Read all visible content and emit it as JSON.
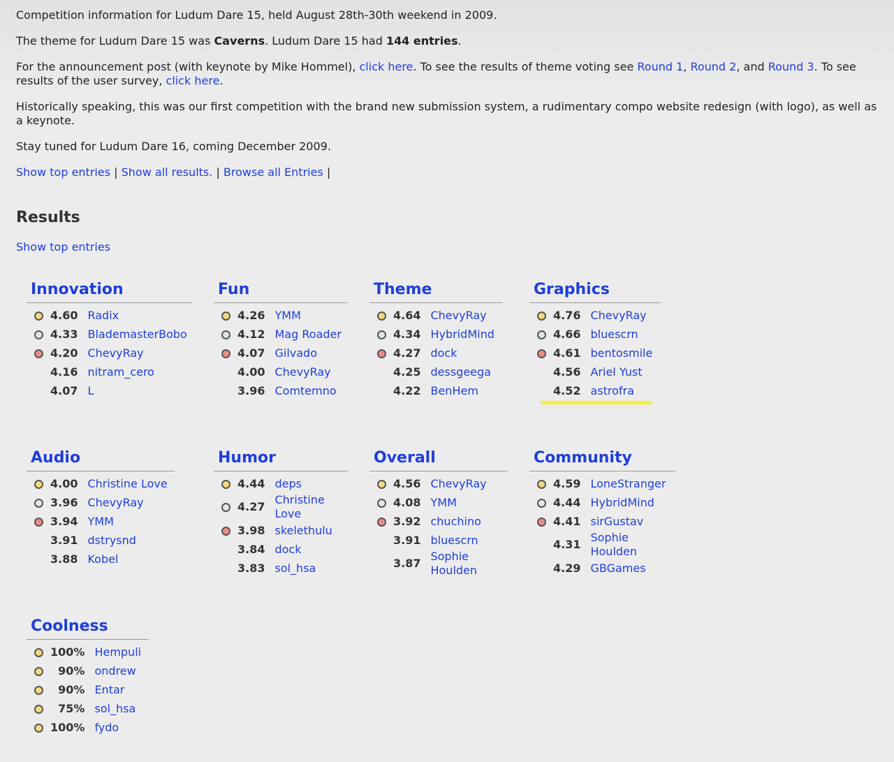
{
  "intro": {
    "line1": "Competition information for Ludum Dare 15, held August 28th-30th weekend in 2009.",
    "line2_a": "The theme for Ludum Dare 15 was ",
    "line2_theme": "Caverns",
    "line2_b": ". Ludum Dare 15 had ",
    "line2_count": "144 entries",
    "line2_c": ".",
    "line3_a": "For the announcement post (with keynote by Mike Hommel), ",
    "line3_link1": "click here",
    "line3_b": ". To see the results of theme voting see ",
    "line3_r1": "Round 1",
    "line3_c": ", ",
    "line3_r2": "Round 2",
    "line3_d": ", and ",
    "line3_r3": "Round 3",
    "line3_e": ". To see results of the user survey, ",
    "line3_link2": "click here",
    "line3_f": ".",
    "line4": "Historically speaking, this was our first competition with the brand new submission system, a rudimentary compo website redesign (with logo), as well as a keynote.",
    "line5": "Stay tuned for Ludum Dare 16, coming December 2009.",
    "nav": [
      "Show top entries",
      "Show all results.",
      "Browse all Entries"
    ]
  },
  "results_heading": "Results",
  "show_top_entries": "Show top entries",
  "categories": [
    {
      "title": "Innovation",
      "entries": [
        {
          "medal": "gold",
          "score": "4.60",
          "name": "Radix"
        },
        {
          "medal": "silver",
          "score": "4.33",
          "name": "BlademasterBobo"
        },
        {
          "medal": "bronze",
          "score": "4.20",
          "name": "ChevyRay"
        },
        {
          "medal": "",
          "score": "4.16",
          "name": "nitram_cero"
        },
        {
          "medal": "",
          "score": "4.07",
          "name": "L"
        }
      ]
    },
    {
      "title": "Fun",
      "entries": [
        {
          "medal": "gold",
          "score": "4.26",
          "name": "YMM"
        },
        {
          "medal": "silver",
          "score": "4.12",
          "name": "Mag Roader"
        },
        {
          "medal": "bronze",
          "score": "4.07",
          "name": "Gilvado"
        },
        {
          "medal": "",
          "score": "4.00",
          "name": "ChevyRay"
        },
        {
          "medal": "",
          "score": "3.96",
          "name": "Comtemno"
        }
      ]
    },
    {
      "title": "Theme",
      "entries": [
        {
          "medal": "gold",
          "score": "4.64",
          "name": "ChevyRay"
        },
        {
          "medal": "silver",
          "score": "4.34",
          "name": "HybridMind"
        },
        {
          "medal": "bronze",
          "score": "4.27",
          "name": "dock"
        },
        {
          "medal": "",
          "score": "4.25",
          "name": "dessgeega"
        },
        {
          "medal": "",
          "score": "4.22",
          "name": "BenHem"
        }
      ]
    },
    {
      "title": "Graphics",
      "entries": [
        {
          "medal": "gold",
          "score": "4.76",
          "name": "ChevyRay"
        },
        {
          "medal": "silver",
          "score": "4.66",
          "name": "bluescrn"
        },
        {
          "medal": "bronze",
          "score": "4.61",
          "name": "bentosmile"
        },
        {
          "medal": "",
          "score": "4.56",
          "name": "Ariel Yust"
        },
        {
          "medal": "",
          "score": "4.52",
          "name": "astrofra"
        }
      ]
    },
    {
      "title": "Audio",
      "entries": [
        {
          "medal": "gold",
          "score": "4.00",
          "name": "Christine Love"
        },
        {
          "medal": "silver",
          "score": "3.96",
          "name": "ChevyRay"
        },
        {
          "medal": "bronze",
          "score": "3.94",
          "name": "YMM"
        },
        {
          "medal": "",
          "score": "3.91",
          "name": "dstrysnd"
        },
        {
          "medal": "",
          "score": "3.88",
          "name": "Kobel"
        }
      ]
    },
    {
      "title": "Humor",
      "entries": [
        {
          "medal": "gold",
          "score": "4.44",
          "name": "deps"
        },
        {
          "medal": "silver",
          "score": "4.27",
          "name": "Christine Love"
        },
        {
          "medal": "bronze",
          "score": "3.98",
          "name": "skelethulu"
        },
        {
          "medal": "",
          "score": "3.84",
          "name": "dock"
        },
        {
          "medal": "",
          "score": "3.83",
          "name": "sol_hsa"
        }
      ]
    },
    {
      "title": "Overall",
      "entries": [
        {
          "medal": "gold",
          "score": "4.56",
          "name": "ChevyRay"
        },
        {
          "medal": "silver",
          "score": "4.08",
          "name": "YMM"
        },
        {
          "medal": "bronze",
          "score": "3.92",
          "name": "chuchino"
        },
        {
          "medal": "",
          "score": "3.91",
          "name": "bluescrn"
        },
        {
          "medal": "",
          "score": "3.87",
          "name": "Sophie Houlden"
        }
      ]
    },
    {
      "title": "Community",
      "entries": [
        {
          "medal": "gold",
          "score": "4.59",
          "name": "LoneStranger"
        },
        {
          "medal": "silver",
          "score": "4.44",
          "name": "HybridMind"
        },
        {
          "medal": "bronze",
          "score": "4.41",
          "name": "sirGustav"
        },
        {
          "medal": "",
          "score": "4.31",
          "name": "Sophie Houlden"
        },
        {
          "medal": "",
          "score": "4.29",
          "name": "GBGames"
        }
      ]
    },
    {
      "title": "Coolness",
      "entries": [
        {
          "medal": "gold",
          "score": "100%",
          "name": "Hempuli"
        },
        {
          "medal": "gold",
          "score": "90%",
          "name": "ondrew"
        },
        {
          "medal": "gold",
          "score": "90%",
          "name": "Entar"
        },
        {
          "medal": "gold",
          "score": "75%",
          "name": "sol_hsa"
        },
        {
          "medal": "gold",
          "score": "100%",
          "name": "fydo"
        }
      ]
    }
  ]
}
